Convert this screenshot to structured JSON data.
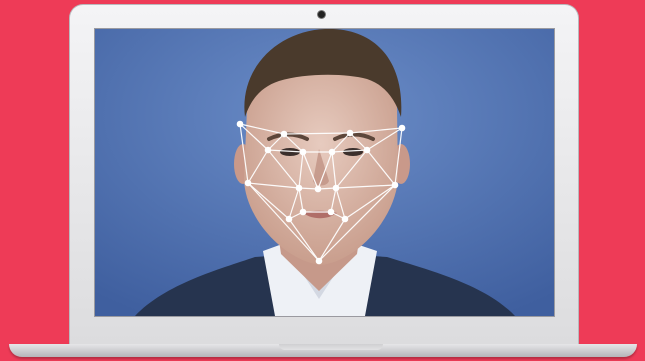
{
  "scene": {
    "background_color": "#ee3b57",
    "screen_background_color": "#5276b4",
    "mesh_color": "#ffffff",
    "screen_content": "face-recognition-mesh-overlay",
    "landmark_count": 22
  }
}
